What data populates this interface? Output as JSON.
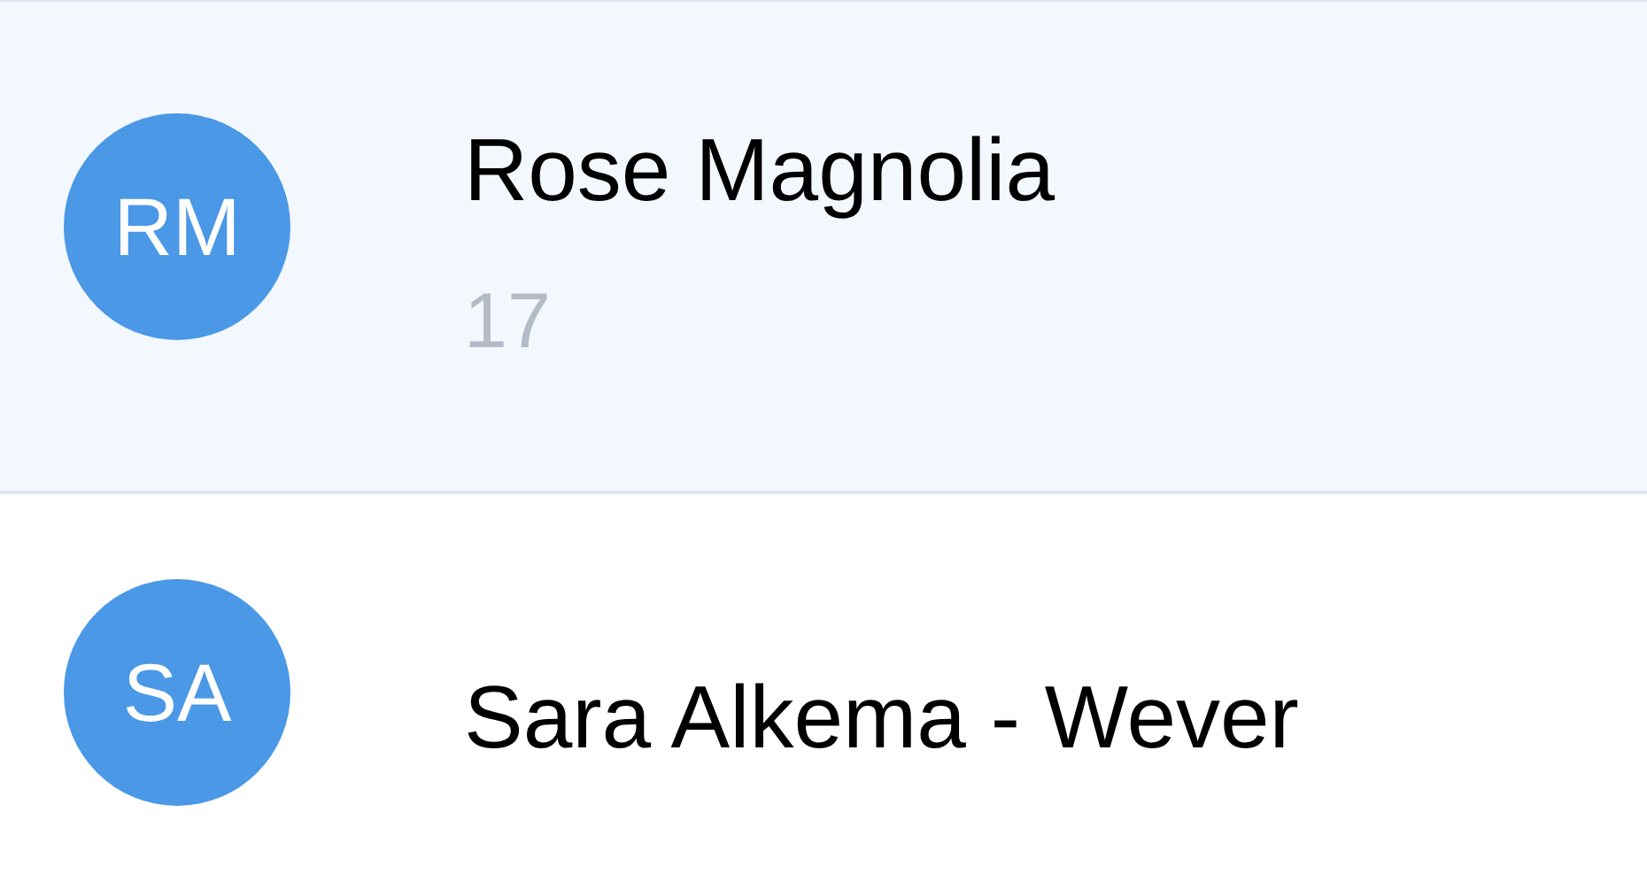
{
  "contacts": [
    {
      "initials": "RM",
      "name": "Rose Magnolia",
      "detail": "17",
      "selected": true
    },
    {
      "initials": "SA",
      "name": "Sara Alkema - Wever",
      "selected": false
    }
  ]
}
